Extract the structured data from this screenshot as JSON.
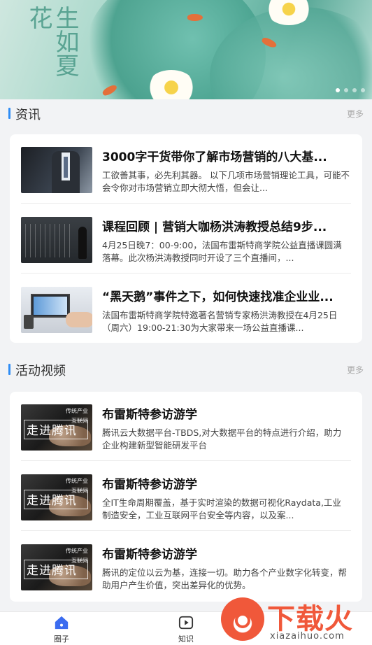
{
  "banner": {
    "calligraphy": "生如夏花",
    "active_dot": 1,
    "dot_count": 4
  },
  "news": {
    "title": "资讯",
    "more": "更多",
    "items": [
      {
        "title": "3000字干货带你了解市场营销的八大基...",
        "desc": "工欲善其事，必先利其器。 以下几项市场营销理论工具，可能不会令你对市场营销立即大彻大悟，但会让..."
      },
      {
        "title": "课程回顾 | 营销大咖杨洪涛教授总结9步...",
        "desc": "4月25日晚7：00-9:00，法国布雷斯特商学院公益直播课圆满落幕。此次杨洪涛教授同时开设了三个直播间，..."
      },
      {
        "title": "“黑天鹅”事件之下，如何快速找准企业业...",
        "desc": "法国布雷斯特商学院特邀著名营销专家杨洪涛教授在4月25日（周六）19:00-21:30为大家带来一场公益直播课..."
      }
    ]
  },
  "videos": {
    "title": "活动视频",
    "more": "更多",
    "thumb_text": {
      "main": "走进腾讯",
      "tag1": "传统产业",
      "tag2": "互联网"
    },
    "items": [
      {
        "title": "布雷斯特参访游学",
        "desc": "腾讯云大数据平台-TBDS,对大数据平台的特点进行介绍，助力企业构建新型智能研发平台"
      },
      {
        "title": "布雷斯特参访游学",
        "desc": "全IT生命周期覆盖，基于实时渲染的数据可视化Raydata,工业制造安全，工业互联网平台安全等内容，以及案..."
      },
      {
        "title": "布雷斯特参访游学",
        "desc": "腾讯的定位以云为基，连接一切。助力各个产业数字化转变，帮助用户产生价值，突出差异化的优势。"
      }
    ]
  },
  "nav": {
    "items": [
      {
        "label": "圈子",
        "icon": "home-icon",
        "active": true
      },
      {
        "label": "知识",
        "icon": "play-icon",
        "active": false
      }
    ]
  },
  "watermark": {
    "brand": "下载火",
    "url": "xiazaihuo.com"
  },
  "colors": {
    "accent": "#2f8df5",
    "watermark": "#f0583a"
  }
}
